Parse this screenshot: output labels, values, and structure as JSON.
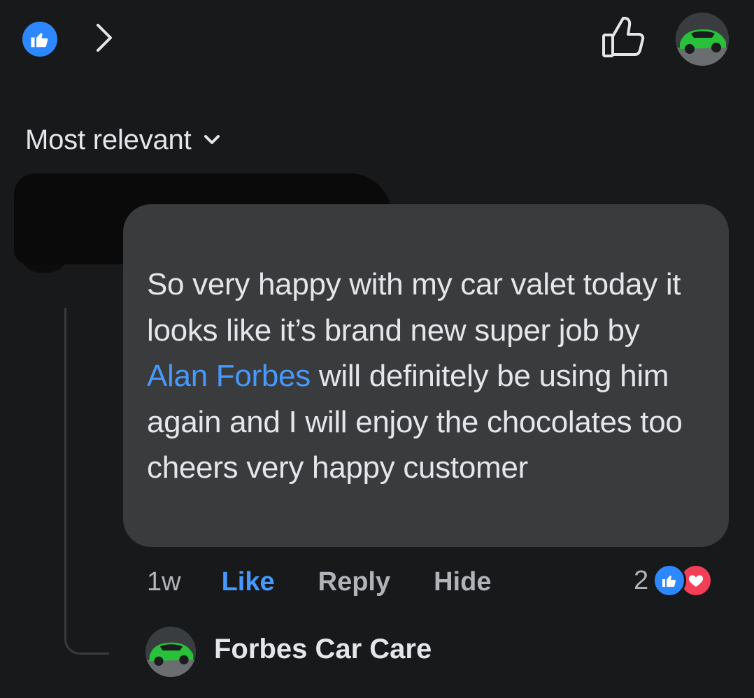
{
  "header": {
    "like_icon": "like-badge-icon",
    "chevron_icon": "chevron-right-icon",
    "thumb_icon": "thumbs-up-outline-icon",
    "avatar_icon": "green-car-avatar"
  },
  "sort": {
    "label": "Most relevant",
    "caret_icon": "chevron-down-icon"
  },
  "comment": {
    "text_before_mention": "So very happy with my car valet today it looks like it’s brand new super job by ",
    "mention": "Alan Forbes",
    "text_after_mention": " will definitely be using him again and I will enjoy the chocolates too cheers very happy customer",
    "time": "1w",
    "like_label": "Like",
    "reply_label": "Reply",
    "hide_label": "Hide",
    "reaction_count": "2",
    "reaction_icons": [
      "like",
      "love"
    ]
  },
  "reply": {
    "author": "Forbes Car Care",
    "avatar_icon": "green-car-avatar"
  },
  "colors": {
    "background": "#18191a",
    "bubble": "#3a3b3c",
    "accent_blue": "#4599ff",
    "like_blue": "#2d88ff",
    "love_red": "#f33e58",
    "secondary_text": "#b0b3b8"
  }
}
